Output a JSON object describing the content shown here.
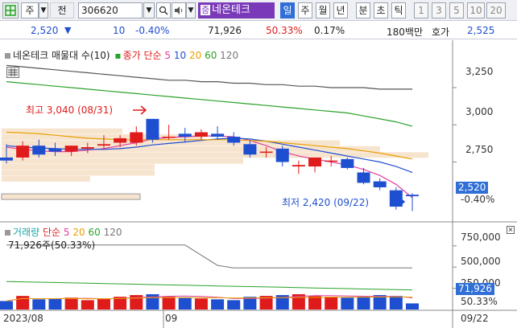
{
  "toolbar": {
    "market": "주",
    "period_label": "전",
    "code": "306620",
    "name_tag": "증",
    "name": "네온테크",
    "tabs": [
      "일",
      "주",
      "월",
      "년",
      "분",
      "초",
      "틱"
    ],
    "selected_tab": "일",
    "numbers": [
      "1",
      "3",
      "5",
      "10",
      "20"
    ]
  },
  "quote": {
    "price": "2,520",
    "direction_arrow": "▼",
    "change": "10",
    "change_pct": "-0.40%",
    "volume": "71,926",
    "volume_ratio": "50.33%",
    "turnover_pct": "0.17%",
    "trade_value": "180백만",
    "ask_label": "호가",
    "ask_price": "2,525"
  },
  "price_panel": {
    "legend_title": "네온테크 매물대 수(10)",
    "legend_ma_label": "종가 단순",
    "ma_periods": [
      "5",
      "10",
      "20",
      "60",
      "120"
    ],
    "ma_colors": [
      "#e040a0",
      "#1f4fd1",
      "#e8a000",
      "#2aa22a",
      "#555555"
    ],
    "high_label": "최고 3,040 (08/31)",
    "low_label": "최저 2,420 (09/22)",
    "current_price": "2,520",
    "current_change_pct": "-0.40%",
    "y_ticks": [
      "3,250",
      "3,000",
      "2,750"
    ]
  },
  "volume_panel": {
    "legend_title": "거래량",
    "legend_ma_label": "단순",
    "ma_periods": [
      "5",
      "20",
      "60",
      "120"
    ],
    "volume_readout": "71,926주(50.33%)",
    "y_ticks": [
      "750,000",
      "500,000",
      "250,000"
    ],
    "current_volume": "71,926",
    "current_ratio": "50.33%"
  },
  "x_axis": {
    "labels": [
      "2023/08",
      "09",
      "09/22"
    ]
  },
  "colors": {
    "up": "#e01b1b",
    "down": "#1f4fd1",
    "accent": "#2f6fd6",
    "volume_profile": "#f7e4cf"
  },
  "chart_data": {
    "type": "candlestick",
    "series": [
      {
        "name": "candles",
        "values": [
          {
            "o": 2780,
            "h": 2870,
            "l": 2740,
            "c": 2760
          },
          {
            "o": 2780,
            "h": 2890,
            "l": 2760,
            "c": 2860
          },
          {
            "o": 2860,
            "h": 2900,
            "l": 2780,
            "c": 2800
          },
          {
            "o": 2840,
            "h": 2880,
            "l": 2790,
            "c": 2820
          },
          {
            "o": 2820,
            "h": 2860,
            "l": 2790,
            "c": 2860
          },
          {
            "o": 2840,
            "h": 2880,
            "l": 2810,
            "c": 2850
          },
          {
            "o": 2860,
            "h": 2930,
            "l": 2840,
            "c": 2870
          },
          {
            "o": 2880,
            "h": 2930,
            "l": 2850,
            "c": 2910
          },
          {
            "o": 2880,
            "h": 2990,
            "l": 2860,
            "c": 2950
          },
          {
            "o": 3040,
            "h": 3040,
            "l": 2880,
            "c": 2900
          },
          {
            "o": 2920,
            "h": 3000,
            "l": 2900,
            "c": 2920
          },
          {
            "o": 2940,
            "h": 2980,
            "l": 2880,
            "c": 2920
          },
          {
            "o": 2920,
            "h": 2970,
            "l": 2900,
            "c": 2950
          },
          {
            "o": 2940,
            "h": 2990,
            "l": 2900,
            "c": 2920
          },
          {
            "o": 2920,
            "h": 2950,
            "l": 2860,
            "c": 2880
          },
          {
            "o": 2870,
            "h": 2900,
            "l": 2780,
            "c": 2800
          },
          {
            "o": 2820,
            "h": 2850,
            "l": 2780,
            "c": 2820
          },
          {
            "o": 2840,
            "h": 2860,
            "l": 2720,
            "c": 2750
          },
          {
            "o": 2720,
            "h": 2760,
            "l": 2670,
            "c": 2730
          },
          {
            "o": 2720,
            "h": 2780,
            "l": 2680,
            "c": 2780
          },
          {
            "o": 2760,
            "h": 2790,
            "l": 2720,
            "c": 2760
          },
          {
            "o": 2770,
            "h": 2780,
            "l": 2700,
            "c": 2710
          },
          {
            "o": 2680,
            "h": 2710,
            "l": 2600,
            "c": 2610
          },
          {
            "o": 2620,
            "h": 2640,
            "l": 2560,
            "c": 2580
          },
          {
            "o": 2560,
            "h": 2580,
            "l": 2430,
            "c": 2450
          },
          {
            "o": 2530,
            "h": 2540,
            "l": 2420,
            "c": 2520
          }
        ]
      },
      {
        "name": "5",
        "values": [
          2850,
          2835,
          2825,
          2820,
          2820,
          2830,
          2840,
          2860,
          2880,
          2905,
          2915,
          2920,
          2925,
          2925,
          2920,
          2895,
          2860,
          2820,
          2790,
          2770,
          2750,
          2730,
          2700,
          2660,
          2600,
          2510
        ]
      },
      {
        "name": "10",
        "values": [
          2860,
          2850,
          2845,
          2840,
          2835,
          2835,
          2835,
          2840,
          2850,
          2865,
          2875,
          2885,
          2895,
          2905,
          2910,
          2905,
          2890,
          2870,
          2850,
          2830,
          2810,
          2790,
          2770,
          2750,
          2720,
          2680
        ]
      },
      {
        "name": "20",
        "values": [
          2950,
          2945,
          2940,
          2930,
          2920,
          2910,
          2905,
          2900,
          2900,
          2900,
          2900,
          2900,
          2900,
          2900,
          2900,
          2895,
          2890,
          2880,
          2870,
          2860,
          2850,
          2840,
          2825,
          2810,
          2790,
          2770
        ]
      },
      {
        "name": "60",
        "values": [
          3290,
          3280,
          3270,
          3260,
          3250,
          3240,
          3230,
          3220,
          3210,
          3200,
          3190,
          3180,
          3170,
          3160,
          3150,
          3140,
          3130,
          3120,
          3110,
          3100,
          3090,
          3080,
          3060,
          3040,
          3020,
          2990
        ]
      },
      {
        "name": "120",
        "values": [
          3400,
          3390,
          3380,
          3370,
          3360,
          3350,
          3340,
          3330,
          3320,
          3310,
          3300,
          3300,
          3290,
          3290,
          3280,
          3280,
          3270,
          3270,
          3260,
          3260,
          3250,
          3250,
          3250,
          3240,
          3240,
          3240
        ]
      },
      {
        "name": "거래량",
        "values": [
          100000,
          160000,
          120000,
          130000,
          140000,
          110000,
          130000,
          150000,
          170000,
          180000,
          150000,
          140000,
          130000,
          120000,
          110000,
          150000,
          160000,
          170000,
          180000,
          160000,
          150000,
          140000,
          150000,
          170000,
          160000,
          71926
        ]
      }
    ]
  }
}
